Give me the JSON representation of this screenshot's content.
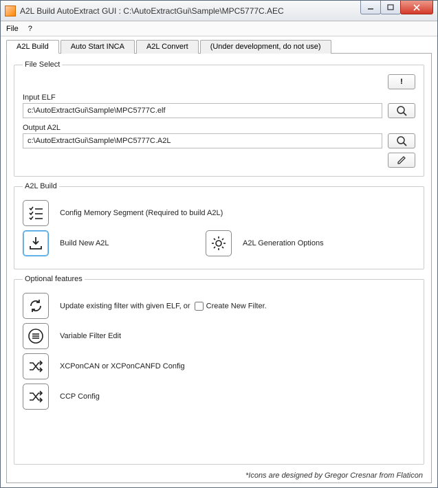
{
  "window": {
    "title": "A2L Build AutoExtract GUI : C:\\AutoExtractGui\\Sample\\MPC5777C.AEC"
  },
  "menu": {
    "file": "File",
    "help": "?"
  },
  "tabs": {
    "build": "A2L Build",
    "autostart": "Auto Start INCA",
    "convert": "A2L Convert",
    "dev": "(Under development, do not use)"
  },
  "file_select": {
    "legend": "File Select",
    "warn_btn": "!",
    "input_elf_label": "Input ELF",
    "input_elf_value": "c:\\AutoExtractGui\\Sample\\MPC5777C.elf",
    "output_a2l_label": "Output A2L",
    "output_a2l_value": "c:\\AutoExtractGui\\Sample\\MPC5777C.A2L"
  },
  "a2l_build": {
    "legend": "A2L Build",
    "config_mem": "Config Memory Segment (Required to build A2L)",
    "build_new": "Build New A2L",
    "gen_options": "A2L Generation Options"
  },
  "optional": {
    "legend": "Optional features",
    "update_filter_prefix": "Update existing filter with given ELF, or",
    "create_new_filter": "Create New Filter.",
    "variable_filter_edit": "Variable Filter Edit",
    "xcp_config": "XCPonCAN or XCPonCANFD Config",
    "ccp_config": "CCP Config"
  },
  "footer": "*Icons are designed by Gregor Cresnar from Flaticon"
}
